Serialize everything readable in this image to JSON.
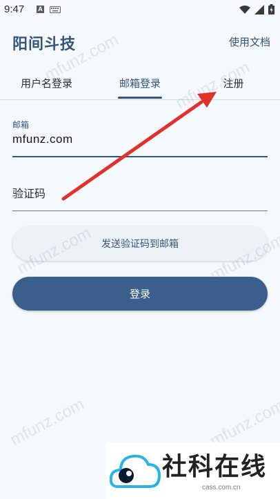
{
  "status_bar": {
    "time": "9:47",
    "notif_icon": "A"
  },
  "app_bar": {
    "title": "阳间斗技",
    "docs_label": "使用文档"
  },
  "tabs": [
    {
      "label": "用户名登录",
      "selected": false
    },
    {
      "label": "邮箱登录",
      "selected": true
    },
    {
      "label": "注册",
      "selected": false
    }
  ],
  "form": {
    "email_label": "邮箱",
    "email_value": "mfunz.com",
    "code_placeholder": "验证码",
    "send_code_label": "发送验证码到邮箱",
    "login_label": "登录"
  },
  "watermark": "mfunz.com",
  "logo": {
    "text": "社科在线",
    "url": "cass.com.cn"
  },
  "colors": {
    "accent": "#32557d",
    "button": "#3a5f8c",
    "arrow": "#e0312b",
    "background": "#f5f8fc"
  }
}
